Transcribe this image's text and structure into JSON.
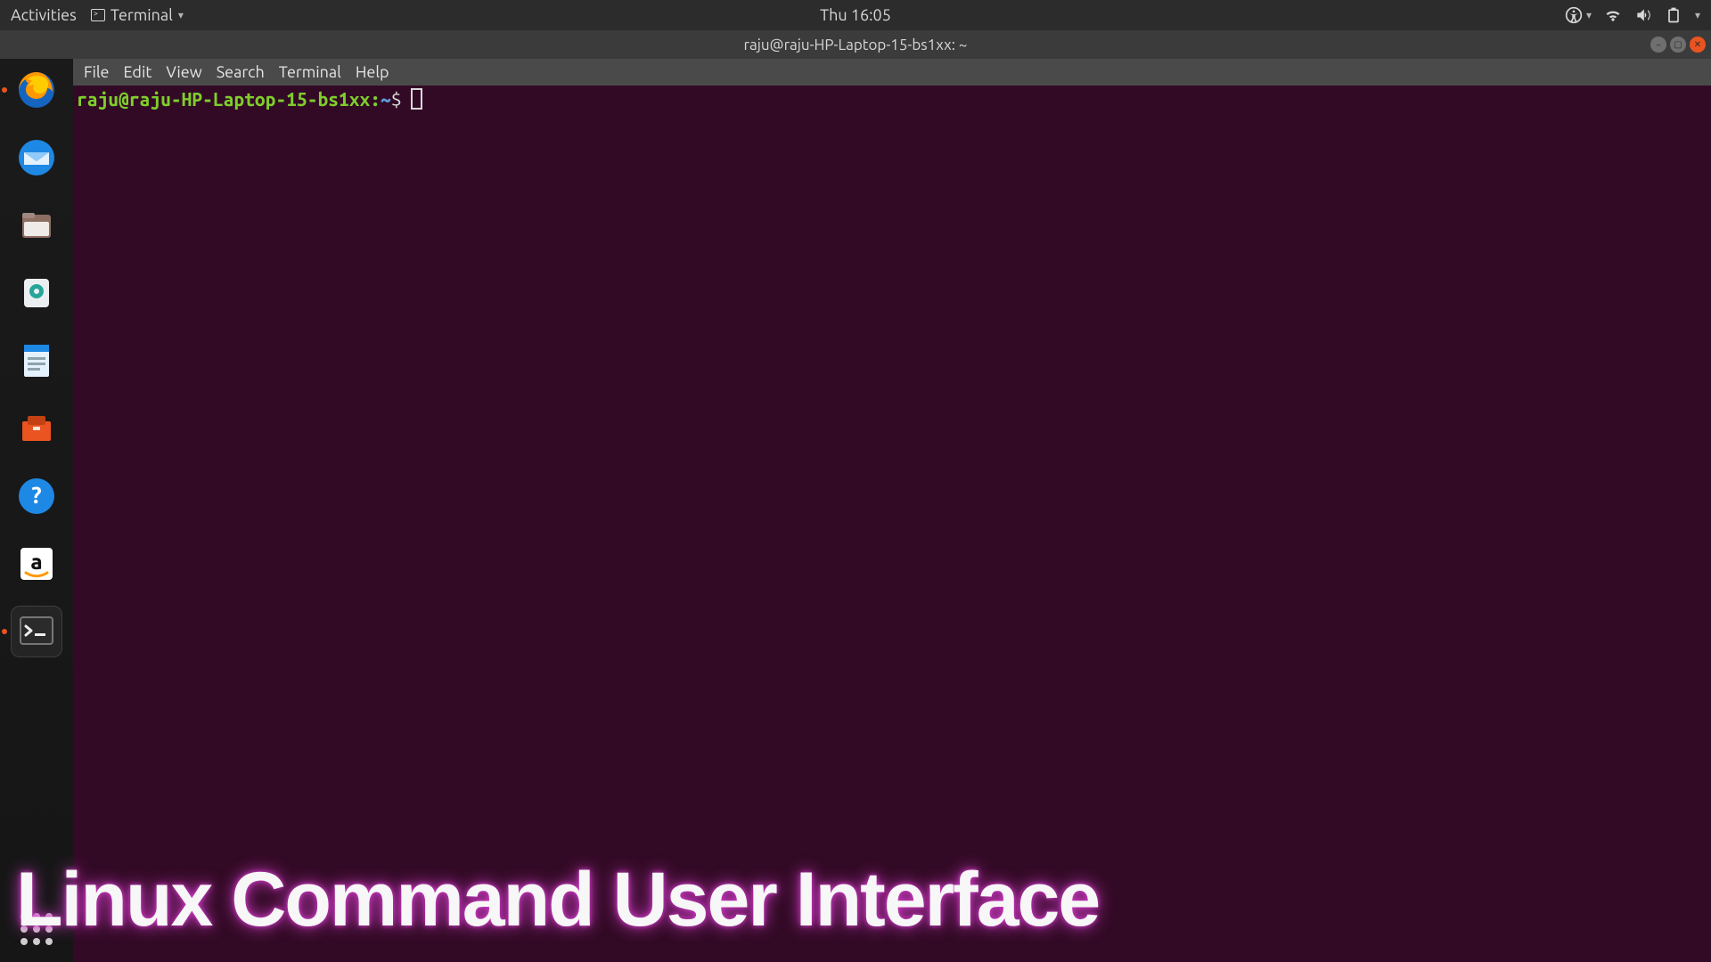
{
  "top_panel": {
    "activities": "Activities",
    "app_name": "Terminal",
    "clock": "Thu 16:05"
  },
  "window": {
    "title": "raju@raju-HP-Laptop-15-bs1xx: ~"
  },
  "menu": {
    "file": "File",
    "edit": "Edit",
    "view": "View",
    "search": "Search",
    "terminal": "Terminal",
    "help": "Help"
  },
  "terminal": {
    "user_host": "raju@raju-HP-Laptop-15-bs1xx",
    "colon": ":",
    "path": "~",
    "prompt_symbol": "$"
  },
  "launcher": {
    "firefox": "Firefox",
    "thunderbird": "Thunderbird",
    "files": "Files",
    "disks": "Disks",
    "writer": "LibreOffice Writer",
    "software": "Ubuntu Software",
    "help": "Help",
    "amazon": "Amazon",
    "terminal": "Terminal"
  },
  "overlay": {
    "caption": "Linux Command User Interface"
  }
}
